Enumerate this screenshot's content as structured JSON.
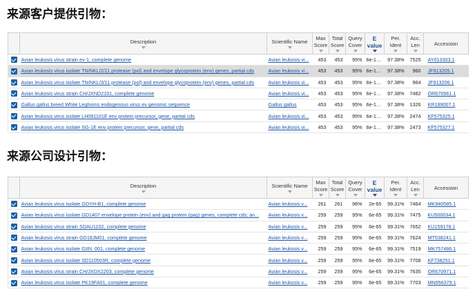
{
  "section1_title": "来源客户提供引物：",
  "section2_title": "来源公司设计引物：",
  "headers": {
    "description": "Description",
    "scientific_name": "Scientific Name",
    "max_score": [
      "Max",
      "Score"
    ],
    "total_score": [
      "Total",
      "Score"
    ],
    "query_cover": [
      "Query",
      "Cover"
    ],
    "e_value": [
      "E",
      "value"
    ],
    "per_ident": [
      "Per.",
      "Ident"
    ],
    "acc_len": [
      "Acc.",
      "Len"
    ],
    "accession": "Accession"
  },
  "table1": {
    "rows": [
      {
        "description": "Avian leukosis virus strain ev-1, complete genome",
        "sci": "Avian leukosis vi...",
        "max": "453",
        "total": "453",
        "cover": "95%",
        "evalue": "6e-123",
        "ident": "97.38%",
        "len": "7525",
        "acc": "AY013303.1",
        "checked": true,
        "highlight": false
      },
      {
        "description": "Avian leukosis virus isolate TN/NKL/2/11 protease (pol) and envelope glycoprotein (env) genes, partial cds",
        "sci": "Avian leukosis vi...",
        "max": "453",
        "total": "453",
        "cover": "95%",
        "evalue": "6e-123",
        "ident": "97.38%",
        "len": "960",
        "acc": "JF913205.1",
        "checked": true,
        "highlight": true
      },
      {
        "description": "Avian leukosis virus isolate TN/NKL/3/11 protease (pol) and envelope glycoprotein (env) genes, partial cds",
        "sci": "Avian leukosis vi...",
        "max": "453",
        "total": "453",
        "cover": "95%",
        "evalue": "6e-123",
        "ident": "97.38%",
        "len": "964",
        "acc": "JF913206.1",
        "checked": true,
        "highlight": false
      },
      {
        "description": "Avian leukosis virus strain CH/JXND2101, complete genome",
        "sci": "Avian leukosis vi...",
        "max": "453",
        "total": "453",
        "cover": "95%",
        "evalue": "6e-123",
        "ident": "97.38%",
        "len": "7482",
        "acc": "OR670961.1",
        "checked": true,
        "highlight": false
      },
      {
        "description": "Gallus gallus breed White Leghorns endogenous virus ev genomic sequence",
        "sci": "Gallus gallus",
        "max": "453",
        "total": "453",
        "cover": "95%",
        "evalue": "6e-123",
        "ident": "97.38%",
        "len": "1326",
        "acc": "KR189007.1",
        "checked": true,
        "highlight": false
      },
      {
        "description": "Avian leukosis virus isolate LH091101E env protein precursor, gene, partial cds",
        "sci": "Avian leukosis vi...",
        "max": "453",
        "total": "453",
        "cover": "95%",
        "evalue": "6e-123",
        "ident": "97.38%",
        "len": "2474",
        "acc": "KF575325.1",
        "checked": true,
        "highlight": false
      },
      {
        "description": "Avian leukosis virus isolate SG-1E env protein precursor, gene, partial cds",
        "sci": "Avian leukosis vi...",
        "max": "453",
        "total": "453",
        "cover": "95%",
        "evalue": "6e-123",
        "ident": "97.38%",
        "len": "2473",
        "acc": "KF575327.1",
        "checked": true,
        "highlight": false
      }
    ]
  },
  "table2": {
    "rows": [
      {
        "description": "Avian leukosis virus isolate GDYH-B1, complete genome",
        "sci": "Avian leukosis v...",
        "max": "261",
        "total": "261",
        "cover": "96%",
        "evalue": "2e-65",
        "ident": "99.31%",
        "len": "7464",
        "acc": "MK940585.1",
        "checked": true,
        "highlight": false
      },
      {
        "description": "Avian leukosis virus isolate GD1407 envelope protein (env) and gag protein (gag) genes, complete cds; an...",
        "sci": "Avian leukosis v...",
        "max": "259",
        "total": "259",
        "cover": "95%",
        "evalue": "6e-65",
        "ident": "99.31%",
        "len": "7475",
        "acc": "KU500034.1",
        "checked": true,
        "highlight": false
      },
      {
        "description": "Avian leukosis virus strain SDAU1102, complete genome",
        "sci": "Avian leukosis v...",
        "max": "259",
        "total": "259",
        "cover": "95%",
        "evalue": "6e-65",
        "ident": "99.31%",
        "len": "7652",
        "acc": "KU159178.1",
        "checked": true,
        "highlight": false
      },
      {
        "description": "Avian leukosis virus strain GD18JM01, complete genome",
        "sci": "Avian leukosis v...",
        "max": "259",
        "total": "259",
        "cover": "95%",
        "evalue": "6e-65",
        "ident": "99.31%",
        "len": "7624",
        "acc": "MT538241.1",
        "checked": true,
        "highlight": false
      },
      {
        "description": "Avian leukosis virus isolate GIIN_001, complete genome",
        "sci": "Avian leukosis v...",
        "max": "259",
        "total": "259",
        "cover": "95%",
        "evalue": "6e-65",
        "ident": "99.31%",
        "len": "7519",
        "acc": "MK757486.1",
        "checked": true,
        "highlight": false
      },
      {
        "description": "Avian leukosis virus isolate SD110503R, complete genome",
        "sci": "Avian leukosis v...",
        "max": "259",
        "total": "259",
        "cover": "95%",
        "evalue": "6e-65",
        "ident": "99.31%",
        "len": "7708",
        "acc": "KF738251.1",
        "checked": true,
        "highlight": false
      },
      {
        "description": "Avian leukosis virus strain CH/JXDX2203, complete genome",
        "sci": "Avian leukosis v...",
        "max": "259",
        "total": "259",
        "cover": "95%",
        "evalue": "6e-65",
        "ident": "99.31%",
        "len": "7635",
        "acc": "OR670971.1",
        "checked": true,
        "highlight": false
      },
      {
        "description": "Avian leukosis virus isolate PK19FA01, complete genome",
        "sci": "Avian leukosis v...",
        "max": "259",
        "total": "259",
        "cover": "95%",
        "evalue": "6e-65",
        "ident": "99.31%",
        "len": "7703",
        "acc": "MN956379.1",
        "checked": true,
        "highlight": false
      }
    ]
  },
  "colors": {
    "link": "#1a55a8",
    "checkbox": "#1a5fa8",
    "highlight_row": "#dcdcdc",
    "header_bg": "#f5f5f5"
  }
}
